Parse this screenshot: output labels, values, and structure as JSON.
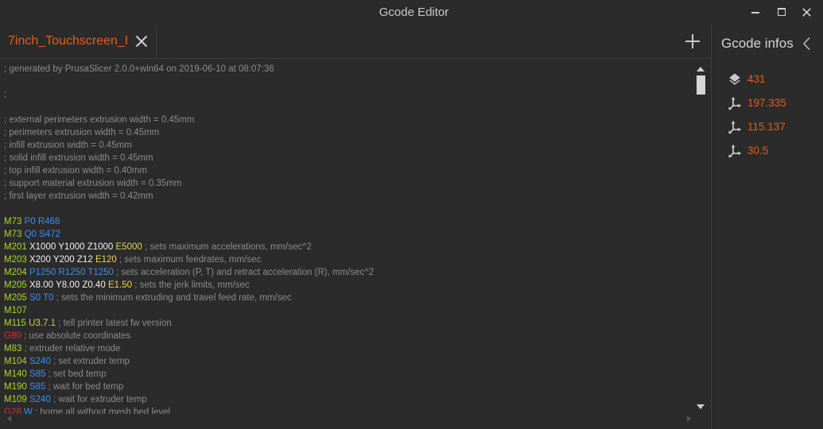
{
  "window": {
    "title": "Gcode Editor"
  },
  "icons": {
    "minimize": "minimize-icon",
    "maximize": "maximize-icon",
    "close": "close-icon",
    "tab_close": "close-icon",
    "add_tab": "plus-icon",
    "collapse_panel": "chevron-left-icon",
    "layers": "layers-icon",
    "axis": "axis-icon"
  },
  "tabs": [
    {
      "label": "7inch_Touchscreen_I"
    }
  ],
  "info_panel": {
    "title": "Gcode infos",
    "items": [
      {
        "icon": "layers-icon",
        "value": "431"
      },
      {
        "icon": "axis-icon",
        "value": "197.335"
      },
      {
        "icon": "axis-icon",
        "value": "115.137"
      },
      {
        "icon": "axis-icon",
        "value": "30.5"
      }
    ]
  },
  "colors": {
    "background": "#2b2b2b",
    "divider": "#3d3d3d",
    "accent": "#e35d1e",
    "comment": "#8b8b8b",
    "m_code": "#a9d42c",
    "g_code": "#e8243c",
    "axis_param": "#f2f2f2",
    "extruder_param": "#e8d84a",
    "other_param": "#3d8eea",
    "version_param": "#c6d54a"
  },
  "editor": {
    "lines": [
      [
        {
          "text": "; generated by PrusaSlicer 2.0.0+win64 on 2019-06-10 at 08:07:36",
          "kind": "comment"
        }
      ],
      [],
      [
        {
          "text": ";",
          "kind": "comment"
        }
      ],
      [],
      [
        {
          "text": "; external perimeters extrusion width = 0.45mm",
          "kind": "comment"
        }
      ],
      [
        {
          "text": "; perimeters extrusion width = 0.45mm",
          "kind": "comment"
        }
      ],
      [
        {
          "text": "; infill extrusion width = 0.45mm",
          "kind": "comment"
        }
      ],
      [
        {
          "text": "; solid infill extrusion width = 0.45mm",
          "kind": "comment"
        }
      ],
      [
        {
          "text": "; top infill extrusion width = 0.40mm",
          "kind": "comment"
        }
      ],
      [
        {
          "text": "; support material extrusion width = 0.35mm",
          "kind": "comment"
        }
      ],
      [
        {
          "text": "; first layer extrusion width = 0.42mm",
          "kind": "comment"
        }
      ],
      [],
      [
        {
          "text": "M73",
          "kind": "m_code"
        },
        {
          "text": "P0",
          "kind": "other_param"
        },
        {
          "text": "R468",
          "kind": "other_param"
        }
      ],
      [
        {
          "text": "M73",
          "kind": "m_code"
        },
        {
          "text": "Q0",
          "kind": "other_param"
        },
        {
          "text": "S472",
          "kind": "other_param"
        }
      ],
      [
        {
          "text": "M201",
          "kind": "m_code"
        },
        {
          "text": "X1000",
          "kind": "axis_param"
        },
        {
          "text": "Y1000",
          "kind": "axis_param"
        },
        {
          "text": "Z1000",
          "kind": "axis_param"
        },
        {
          "text": "E5000",
          "kind": "extruder_param"
        },
        {
          "text": "; sets maximum accelerations, mm/sec^2",
          "kind": "comment"
        }
      ],
      [
        {
          "text": "M203",
          "kind": "m_code"
        },
        {
          "text": "X200",
          "kind": "axis_param"
        },
        {
          "text": "Y200",
          "kind": "axis_param"
        },
        {
          "text": "Z12",
          "kind": "axis_param"
        },
        {
          "text": "E120",
          "kind": "extruder_param"
        },
        {
          "text": "; sets maximum feedrates, mm/sec",
          "kind": "comment"
        }
      ],
      [
        {
          "text": "M204",
          "kind": "m_code"
        },
        {
          "text": "P1250",
          "kind": "other_param"
        },
        {
          "text": "R1250",
          "kind": "other_param"
        },
        {
          "text": "T1250",
          "kind": "other_param"
        },
        {
          "text": "; sets acceleration (P, T) and retract acceleration (R), mm/sec^2",
          "kind": "comment"
        }
      ],
      [
        {
          "text": "M205",
          "kind": "m_code"
        },
        {
          "text": "X8.00",
          "kind": "axis_param"
        },
        {
          "text": "Y8.00",
          "kind": "axis_param"
        },
        {
          "text": "Z0.40",
          "kind": "axis_param"
        },
        {
          "text": "E1.50",
          "kind": "extruder_param"
        },
        {
          "text": "; sets the jerk limits, mm/sec",
          "kind": "comment"
        }
      ],
      [
        {
          "text": "M205",
          "kind": "m_code"
        },
        {
          "text": "S0",
          "kind": "other_param"
        },
        {
          "text": "T0",
          "kind": "other_param"
        },
        {
          "text": "; sets the minimum extruding and travel feed rate, mm/sec",
          "kind": "comment"
        }
      ],
      [
        {
          "text": "M107",
          "kind": "m_code"
        }
      ],
      [
        {
          "text": "M115",
          "kind": "m_code"
        },
        {
          "text": "U3.7.1",
          "kind": "version_param"
        },
        {
          "text": "; tell printer latest fw version",
          "kind": "comment"
        }
      ],
      [
        {
          "text": "G90",
          "kind": "g_code"
        },
        {
          "text": "; use absolute coordinates",
          "kind": "comment"
        }
      ],
      [
        {
          "text": "M83",
          "kind": "m_code"
        },
        {
          "text": "; extruder relative mode",
          "kind": "comment"
        }
      ],
      [
        {
          "text": "M104",
          "kind": "m_code"
        },
        {
          "text": "S240",
          "kind": "other_param"
        },
        {
          "text": "; set extruder temp",
          "kind": "comment"
        }
      ],
      [
        {
          "text": "M140",
          "kind": "m_code"
        },
        {
          "text": "S85",
          "kind": "other_param"
        },
        {
          "text": "; set bed temp",
          "kind": "comment"
        }
      ],
      [
        {
          "text": "M190",
          "kind": "m_code"
        },
        {
          "text": "S85",
          "kind": "other_param"
        },
        {
          "text": "; wait for bed temp",
          "kind": "comment"
        }
      ],
      [
        {
          "text": "M109",
          "kind": "m_code"
        },
        {
          "text": "S240",
          "kind": "other_param"
        },
        {
          "text": "; wait for extruder temp",
          "kind": "comment"
        }
      ],
      [
        {
          "text": "G28",
          "kind": "g_code"
        },
        {
          "text": "W",
          "kind": "other_param"
        },
        {
          "text": "; home all without mesh bed level",
          "kind": "comment"
        }
      ]
    ]
  }
}
